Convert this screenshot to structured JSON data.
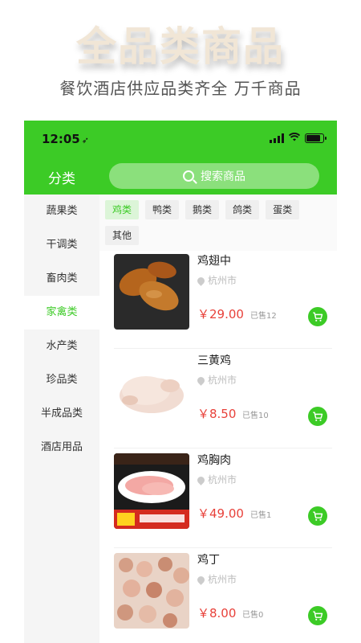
{
  "promo": {
    "title": "全品类商品",
    "subtitle": "餐饮酒店供应品类齐全 万千商品"
  },
  "status": {
    "time": "12:05",
    "location_glyph": "➶"
  },
  "nav": {
    "title": "分类",
    "search_placeholder": "搜索商品"
  },
  "sidebar": {
    "items": [
      {
        "label": "蔬果类",
        "active": false
      },
      {
        "label": "干调类",
        "active": false
      },
      {
        "label": "畜肉类",
        "active": false
      },
      {
        "label": "家禽类",
        "active": true
      },
      {
        "label": "水产类",
        "active": false
      },
      {
        "label": "珍品类",
        "active": false
      },
      {
        "label": "半成品类",
        "active": false
      },
      {
        "label": "酒店用品",
        "active": false
      }
    ]
  },
  "subcategories": [
    {
      "label": "鸡类",
      "active": true
    },
    {
      "label": "鸭类",
      "active": false
    },
    {
      "label": "鹅类",
      "active": false
    },
    {
      "label": "鸽类",
      "active": false
    },
    {
      "label": "蛋类",
      "active": false
    },
    {
      "label": "其他",
      "active": false
    }
  ],
  "products": [
    {
      "name": "鸡翅中",
      "location": "杭州市",
      "price": "￥29.00",
      "sold": "已售12"
    },
    {
      "name": "三黄鸡",
      "location": "杭州市",
      "price": "￥8.50",
      "sold": "已售10"
    },
    {
      "name": "鸡胸肉",
      "location": "杭州市",
      "price": "￥49.00",
      "sold": "已售1"
    },
    {
      "name": "鸡丁",
      "location": "杭州市",
      "price": "￥8.00",
      "sold": "已售0"
    }
  ],
  "colors": {
    "brand_green": "#3ccb26",
    "price_red": "#e8413a"
  }
}
